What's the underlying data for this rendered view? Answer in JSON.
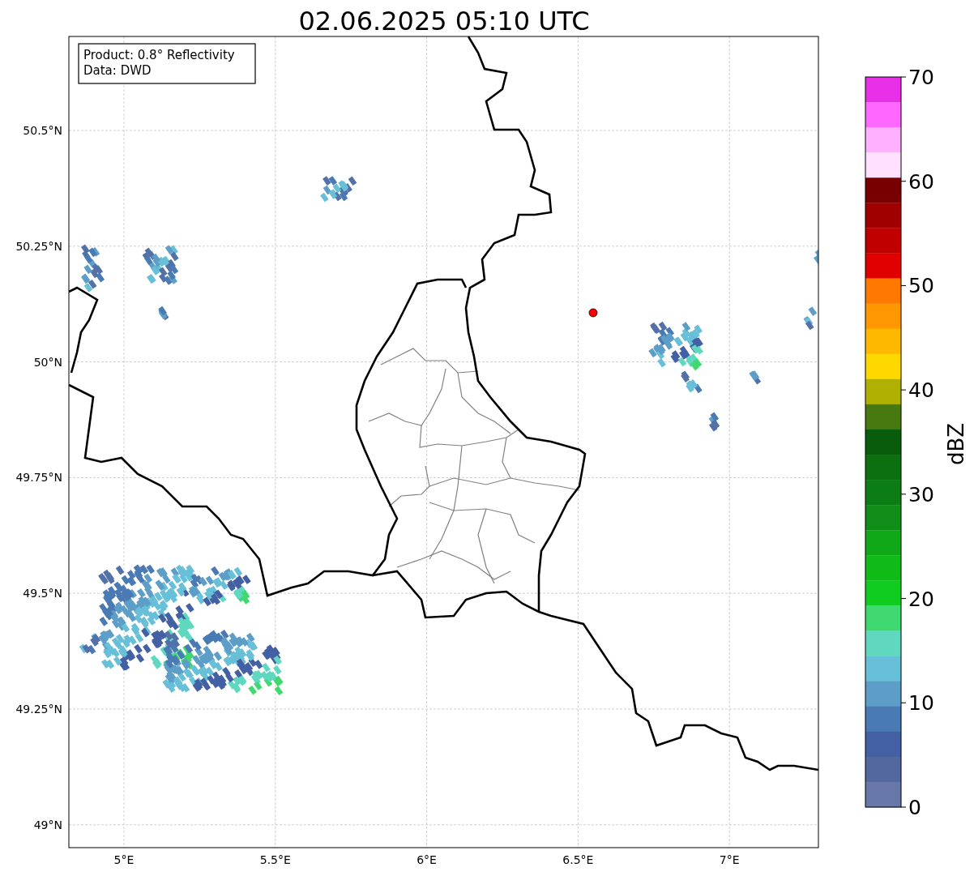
{
  "title": "02.06.2025 05:10 UTC",
  "info_box": {
    "lines": [
      "Product: 0.8° Reflectivity",
      "Data: DWD"
    ]
  },
  "map": {
    "x_tick_labels": [
      "5°E",
      "5.5°E",
      "6°E",
      "6.5°E",
      "7°E"
    ],
    "y_tick_labels": [
      "50.5°N",
      "50.25°N",
      "50°N",
      "49.75°N",
      "49.5°N",
      "49.25°N",
      "49°N"
    ]
  },
  "colorbar": {
    "label": "dBZ",
    "tick_labels": [
      "70",
      "60",
      "50",
      "40",
      "30",
      "20",
      "10",
      "0"
    ],
    "segments": [
      {
        "color": "#e830e8"
      },
      {
        "color": "#ff68ff"
      },
      {
        "color": "#ffb0ff"
      },
      {
        "color": "#ffe0ff"
      },
      {
        "color": "#780000"
      },
      {
        "color": "#a00000"
      },
      {
        "color": "#c00000"
      },
      {
        "color": "#e00000"
      },
      {
        "color": "#ff7800"
      },
      {
        "color": "#ff9800"
      },
      {
        "color": "#ffb800"
      },
      {
        "color": "#ffd800"
      },
      {
        "color": "#b0b000"
      },
      {
        "color": "#487810"
      },
      {
        "color": "#085c0c"
      },
      {
        "color": "#0c7010"
      },
      {
        "color": "#0c7c14"
      },
      {
        "color": "#108c18"
      },
      {
        "color": "#10a818"
      },
      {
        "color": "#10bb18"
      },
      {
        "color": "#10cc20"
      },
      {
        "color": "#40d870"
      },
      {
        "color": "#60d8c0"
      },
      {
        "color": "#68c0d8"
      },
      {
        "color": "#5c9ec8"
      },
      {
        "color": "#4a7ab4"
      },
      {
        "color": "#4460a4"
      },
      {
        "color": "#5468a0"
      },
      {
        "color": "#6677a8"
      }
    ]
  }
}
